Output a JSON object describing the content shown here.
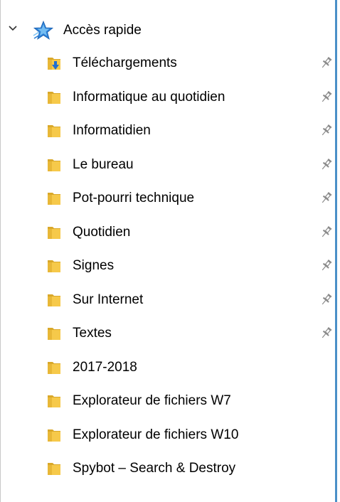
{
  "quick_access": {
    "label": "Accès rapide",
    "expand_icon": "chevron-down-icon",
    "icon": "quick-access-star-icon",
    "colors": {
      "star_blue": "#2b7fd6",
      "star_light": "#7cc4f5",
      "folder_yellow": "#f6c94a",
      "folder_dark": "#d9a82a",
      "download_arrow": "#1f6fd1",
      "pin": "#8a8a8a"
    }
  },
  "items": [
    {
      "label": "Téléchargements",
      "icon": "downloads-folder-icon",
      "pinned": true
    },
    {
      "label": "Informatique au quotidien",
      "icon": "folder-icon",
      "pinned": true
    },
    {
      "label": "Informatidien",
      "icon": "folder-icon",
      "pinned": true
    },
    {
      "label": "Le bureau",
      "icon": "folder-icon",
      "pinned": true
    },
    {
      "label": "Pot-pourri technique",
      "icon": "folder-icon",
      "pinned": true
    },
    {
      "label": "Quotidien",
      "icon": "folder-icon",
      "pinned": true
    },
    {
      "label": "Signes",
      "icon": "folder-icon",
      "pinned": true
    },
    {
      "label": "Sur Internet",
      "icon": "folder-icon",
      "pinned": true
    },
    {
      "label": "Textes",
      "icon": "folder-icon",
      "pinned": true
    },
    {
      "label": "2017-2018",
      "icon": "folder-icon",
      "pinned": false
    },
    {
      "label": "Explorateur de fichiers W7",
      "icon": "folder-icon",
      "pinned": false
    },
    {
      "label": "Explorateur de fichiers W10",
      "icon": "folder-icon",
      "pinned": false
    },
    {
      "label": "Spybot – Search & Destroy",
      "icon": "folder-icon",
      "pinned": false
    }
  ]
}
